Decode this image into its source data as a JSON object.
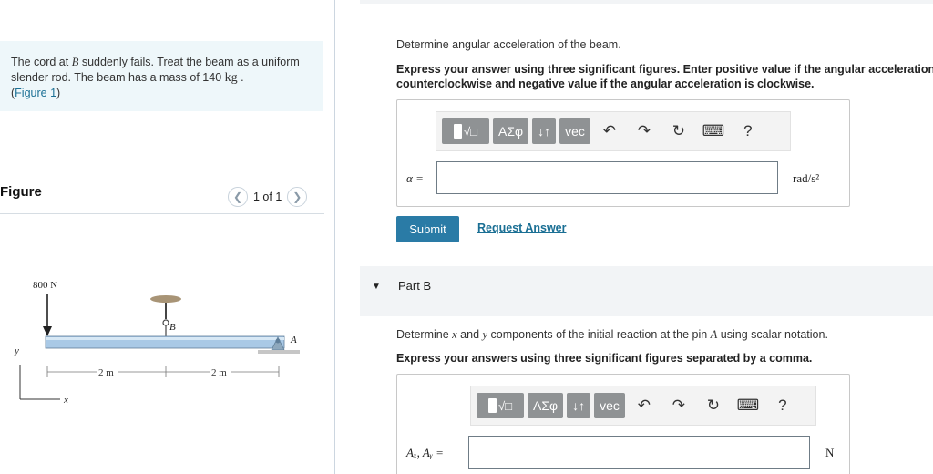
{
  "problem": {
    "text_before": "The cord at ",
    "var_B": "B",
    "text_after": " suddenly fails. Treat the beam as a uniform slender rod. The beam has a mass of 140 ",
    "unit_kg": "kg",
    "period": " .",
    "figure_link": "Figure 1"
  },
  "figure": {
    "heading": "Figure",
    "page_indicator": "1 of 1",
    "force_label": "800 N",
    "label_B": "B",
    "label_A": "A",
    "axis_y": "y",
    "axis_x": "x",
    "dim_left": "2 m",
    "dim_right": "2 m"
  },
  "part_a": {
    "question": "Determine angular acceleration of the beam.",
    "instruction_line1": "Express your answer using three significant figures. Enter positive value if the angular acceleration is",
    "instruction_line2": "counterclockwise and negative value if the angular acceleration is clockwise.",
    "variable": "α =",
    "unit": "rad/s²",
    "input_value": "",
    "submit_label": "Submit",
    "request_label": "Request Answer"
  },
  "part_b": {
    "title": "Part B",
    "question_pre": "Determine ",
    "question_x": "x",
    "question_mid": " and ",
    "question_y": "y",
    "question_post": " components of the initial reaction at the pin ",
    "question_A": "A",
    "question_end": " using scalar notation.",
    "instruction": "Express your answers using three significant figures separated by a comma.",
    "variable": "Aₓ, Aᵧ =",
    "unit": "N",
    "input_value": ""
  },
  "toolbar": {
    "greek_label": "ΑΣφ",
    "arrows_label": "↓↑",
    "vec_label": "vec",
    "help_label": "?",
    "undo_icon": "undo-icon",
    "redo_icon": "redo-icon",
    "reset_icon": "reset-icon",
    "keyboard_icon": "keyboard-icon"
  }
}
